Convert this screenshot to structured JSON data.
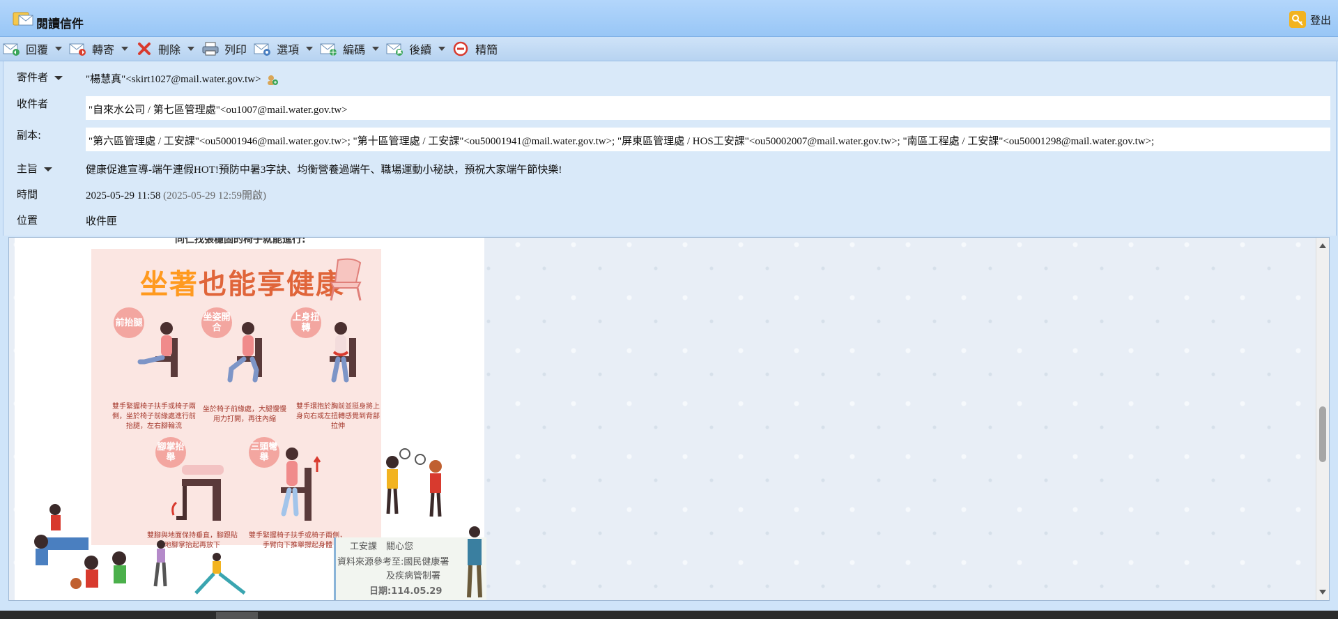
{
  "window": {
    "title": "閱讀信件",
    "logout_label": "登出"
  },
  "toolbar": {
    "reply": "回覆",
    "forward": "轉寄",
    "delete": "刪除",
    "print": "列印",
    "options": "選項",
    "encoding": "編碼",
    "followup": "後續",
    "simplify": "精簡"
  },
  "message": {
    "from_label": "寄件者",
    "from_value": "\"楊慧真\"<skirt1027@mail.water.gov.tw>",
    "to_label": "收件者",
    "to_value": "\"自來水公司 / 第七區管理處\"<ou1007@mail.water.gov.tw>",
    "cc_label": "副本:",
    "cc_value": "\"第六區管理處 / 工安課\"<ou50001946@mail.water.gov.tw>; \"第十區管理處 / 工安課\"<ou50001941@mail.water.gov.tw>; \"屏東區管理處 / HOS工安課\"<ou50002007@mail.water.gov.tw>; \"南區工程處 / 工安課\"<ou50001298@mail.water.gov.tw>;",
    "subject_label": "主旨",
    "subject_value": "健康促進宣導-端午連假HOT!預防中暑3字訣、均衡營養過端午、職場運動小秘訣，預祝大家端午節快樂!",
    "time_label": "時間",
    "time_value": "2025-05-29 11:58",
    "time_opened": "(2025-05-29 12:59開啟)",
    "location_label": "位置",
    "location_value": "收件匣"
  },
  "body": {
    "caption": "同仁找張穩固的椅子就能進行:",
    "poster_title_1": "坐著",
    "poster_title_2": "也能享健康",
    "exercises": [
      {
        "tag": "前抬腿",
        "caption": "雙手緊握椅子扶手或椅子兩側，坐於椅子前緣處進行前抬腿，左右腳輪流"
      },
      {
        "tag": "坐姿開合",
        "caption": "坐於椅子前緣處，大腿慢慢用力打開，再往內縮"
      },
      {
        "tag": "上身扭轉",
        "caption": "雙手環抱於胸前並挺身將上身向右或左扭轉感覺到背部拉伸"
      },
      {
        "tag": "腳掌抬舉",
        "caption": "雙腳與地面保持垂直，腳跟貼地腳掌抬起再放下"
      },
      {
        "tag": "三頭彎舉",
        "caption": "雙手緊握椅子扶手或椅子兩側，手臂向下推舉撐起身體"
      }
    ],
    "credit_1": "工安課　關心您",
    "credit_2": "資料來源參考至:國民健康署",
    "credit_3": "及疾病管制署",
    "credit_4": "日期:114.05.29"
  },
  "colors": {
    "titlebar": "#a9d0f8",
    "panel": "#d9e9f9",
    "accent_red": "#d83a2e"
  }
}
